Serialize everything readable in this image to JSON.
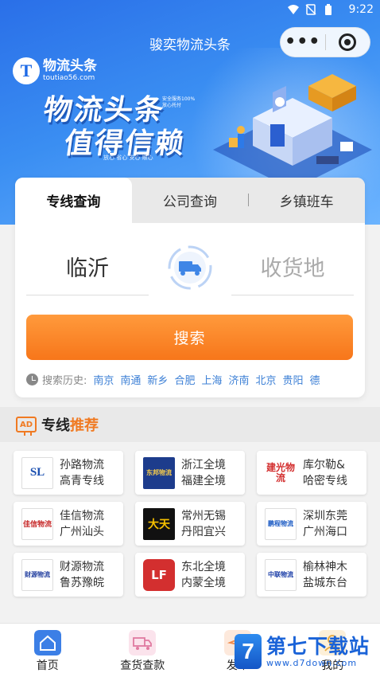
{
  "status_bar": {
    "time": "9:22",
    "icons": [
      "wifi-icon",
      "no-sim-icon",
      "battery-icon"
    ]
  },
  "header": {
    "title": "骏奕物流头条",
    "capsule_more": "•••",
    "logo_name": "物流头条",
    "logo_domain": "toutiao56.com"
  },
  "banner": {
    "slogan_line1": "物流头条",
    "slogan_line2": "值得信赖",
    "slogan_small_line1": "安全服务100%",
    "slogan_small_line2": "放心托付",
    "slogan_sub": "放心 省心 安心 顺心"
  },
  "tabs": [
    {
      "label": "专线查询",
      "active": true
    },
    {
      "label": "公司查询",
      "active": false
    },
    {
      "label": "乡镇班车",
      "active": false
    }
  ],
  "route": {
    "from": "临沂",
    "to_placeholder": "收货地"
  },
  "search_button": "搜索",
  "history": {
    "label": "搜索历史:",
    "items": [
      "南京",
      "南通",
      "新乡",
      "合肥",
      "上海",
      "济南",
      "北京",
      "贵阳",
      "德"
    ]
  },
  "recommend": {
    "ad_badge": "AD",
    "title_normal": "专线",
    "title_highlight": "推荐"
  },
  "companies": [
    {
      "name": "孙路物流",
      "route": "高青专线",
      "logo_text": "SL"
    },
    {
      "name": "浙江全境",
      "route": "福建全境",
      "logo_text": "东邦物流"
    },
    {
      "name": "库尔勒&",
      "route": "哈密专线",
      "logo_text": "建光物流"
    },
    {
      "name": "佳信物流",
      "route": "广州汕头",
      "logo_text": "佳信物流"
    },
    {
      "name": "常州无锡",
      "route": "丹阳宜兴",
      "logo_text": "大天"
    },
    {
      "name": "深圳东莞",
      "route": "广州海口",
      "logo_text": "鹏程物流"
    },
    {
      "name": "财源物流",
      "route": "鲁苏豫皖",
      "logo_text": "财源物流"
    },
    {
      "name": "东北全境",
      "route": "内蒙全境",
      "logo_text": "LF"
    },
    {
      "name": "榆林神木",
      "route": "盐城东台",
      "logo_text": "中联物流"
    }
  ],
  "bottom_nav": [
    {
      "label": "首页",
      "icon": "home-icon"
    },
    {
      "label": "查货查款",
      "icon": "truck-icon"
    },
    {
      "label": "发布",
      "icon": "send-icon"
    },
    {
      "label": "我的",
      "icon": "user-icon"
    }
  ],
  "watermark": {
    "cn": "第七下载站",
    "en": "www.d7down.com",
    "logo": "7"
  },
  "colors": {
    "primary_blue": "#2a6fe8",
    "orange": "#f7761a",
    "link_blue": "#3d80d6"
  }
}
